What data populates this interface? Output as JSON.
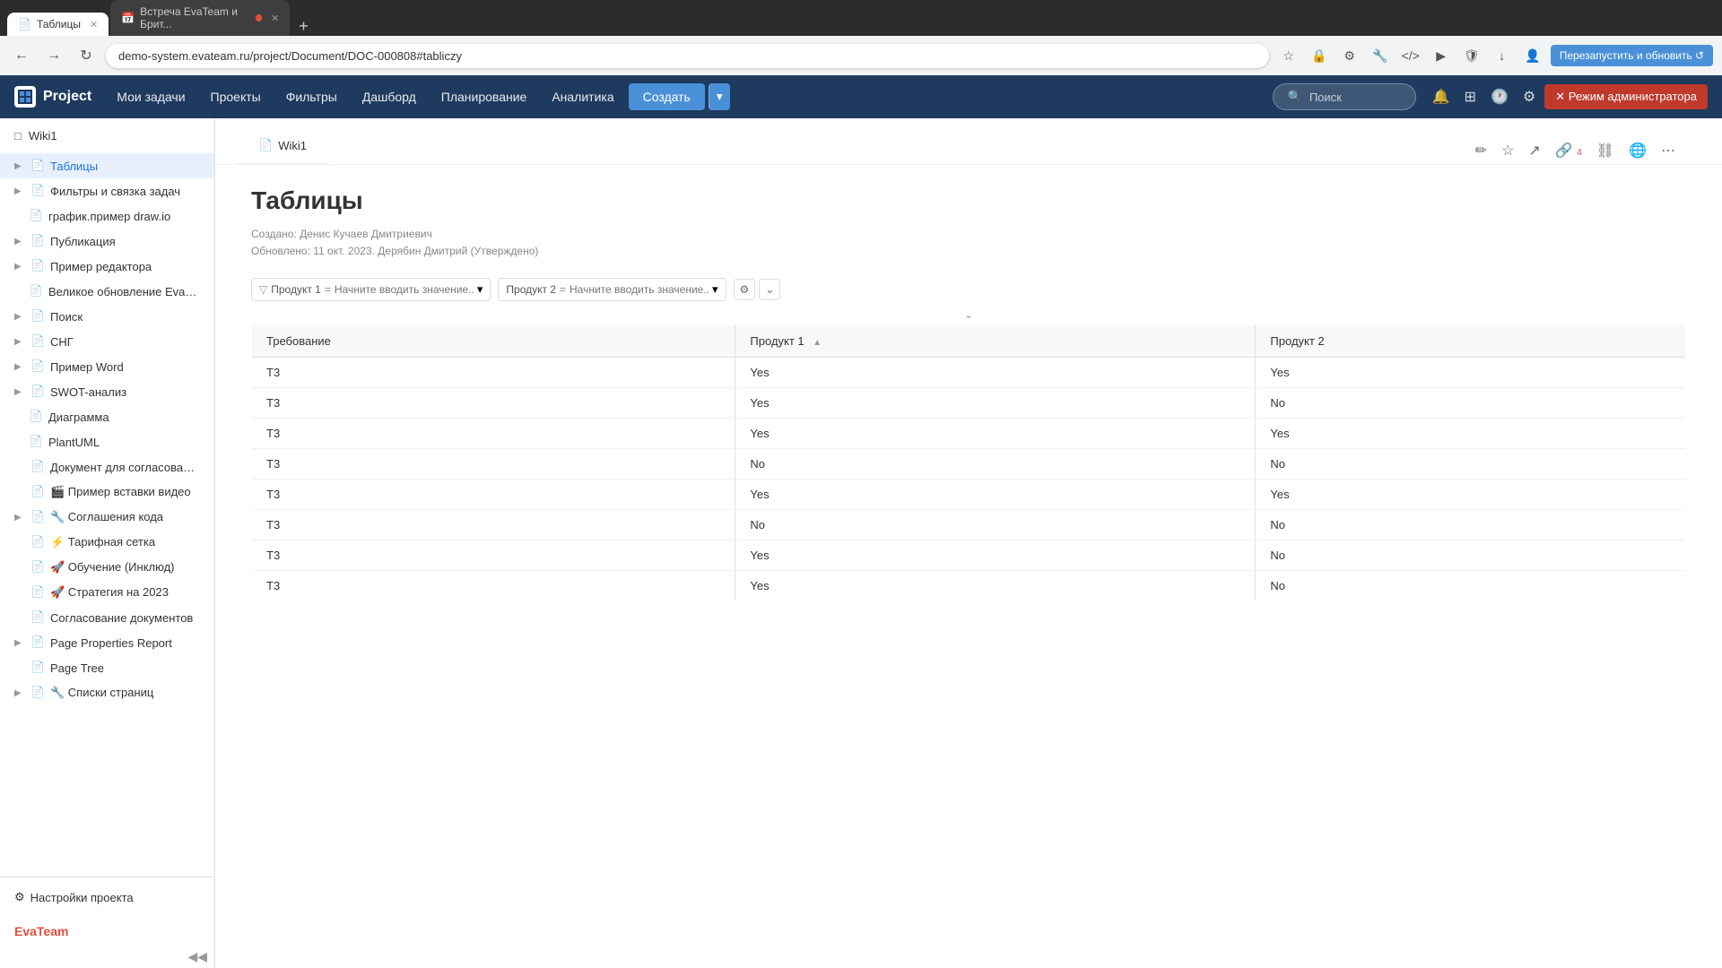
{
  "browser": {
    "tabs": [
      {
        "id": "tab1",
        "label": "Таблицы",
        "active": true,
        "icon": "📄"
      },
      {
        "id": "tab2",
        "label": "Встреча EvaTeam и Брит...",
        "active": false,
        "icon": "📅"
      }
    ],
    "address": "demo-system.evateam.ru/project/Document/DOC-000808#tabliczy",
    "restart_label": "Перезапустить и обновить ↺"
  },
  "nav": {
    "logo": "Project",
    "items": [
      "Мои задачи",
      "Проекты",
      "Фильтры",
      "Дашборд",
      "Планирование",
      "Аналитика"
    ],
    "create_label": "Создать",
    "search_placeholder": "Поиск",
    "admin_label": "✕ Режим администратора"
  },
  "sidebar": {
    "wiki_title": "Wiki1",
    "items": [
      {
        "id": "tablicy",
        "label": "Таблицы",
        "active": true,
        "expandable": true,
        "icon": "📄",
        "indent": 0
      },
      {
        "id": "filtry",
        "label": "Фильтры и связка задач",
        "active": false,
        "expandable": true,
        "icon": "📄",
        "indent": 0
      },
      {
        "id": "grafik",
        "label": "график.пример draw.io",
        "active": false,
        "expandable": false,
        "icon": "📄",
        "indent": 1
      },
      {
        "id": "publikaciya",
        "label": "Публикация",
        "active": false,
        "expandable": true,
        "icon": "📄",
        "indent": 0
      },
      {
        "id": "primer-red",
        "label": "Пример редактора",
        "active": false,
        "expandable": true,
        "icon": "📄",
        "indent": 0
      },
      {
        "id": "velikoe",
        "label": "Великое обновление EvaP...",
        "active": false,
        "expandable": false,
        "icon": "📄",
        "indent": 1
      },
      {
        "id": "poisk",
        "label": "Поиск",
        "active": false,
        "expandable": true,
        "icon": "📄",
        "indent": 0
      },
      {
        "id": "sng",
        "label": "СНГ",
        "active": false,
        "expandable": true,
        "icon": "📄",
        "indent": 0
      },
      {
        "id": "primer-word",
        "label": "Пример Word",
        "active": false,
        "expandable": true,
        "icon": "📄",
        "indent": 0
      },
      {
        "id": "swot",
        "label": "SWOT-анализ",
        "active": false,
        "expandable": true,
        "icon": "📄",
        "indent": 0
      },
      {
        "id": "diagramma",
        "label": "Диаграмма",
        "active": false,
        "expandable": false,
        "icon": "📄",
        "indent": 1
      },
      {
        "id": "plantuml",
        "label": "PlantUML",
        "active": false,
        "expandable": false,
        "icon": "📄",
        "indent": 1
      },
      {
        "id": "soglasovanie",
        "label": "Документ для согласования",
        "active": false,
        "expandable": false,
        "icon": "📄",
        "indent": 0
      },
      {
        "id": "video",
        "label": "🎬 Пример вставки видео",
        "active": false,
        "expandable": false,
        "icon": "📄",
        "indent": 0
      },
      {
        "id": "soglasheniya",
        "label": "🔧 Соглашения кода",
        "active": false,
        "expandable": true,
        "icon": "📄",
        "indent": 0
      },
      {
        "id": "tarifnaya",
        "label": "⚡ Тарифная сетка",
        "active": false,
        "expandable": false,
        "icon": "📄",
        "indent": 0
      },
      {
        "id": "obuchenie",
        "label": "🚀 Обучение (Инклюд)",
        "active": false,
        "expandable": false,
        "icon": "📄",
        "indent": 0
      },
      {
        "id": "strategiya",
        "label": "🚀 Стратегия на 2023",
        "active": false,
        "expandable": false,
        "icon": "📄",
        "indent": 0
      },
      {
        "id": "soglasovanie-doc",
        "label": "Согласование документов",
        "active": false,
        "expandable": false,
        "icon": "📄",
        "indent": 0
      },
      {
        "id": "page-properties-report",
        "label": "Page Properties Report",
        "active": false,
        "expandable": true,
        "icon": "📄",
        "indent": 0
      },
      {
        "id": "page-tree",
        "label": "Page Tree",
        "active": false,
        "expandable": false,
        "icon": "📄",
        "indent": 0
      },
      {
        "id": "spiski",
        "label": "🔧 Списки страниц",
        "active": false,
        "expandable": true,
        "icon": "📄",
        "indent": 0
      }
    ],
    "settings_label": "Настройки проекта",
    "collapse_icon": "◀◀"
  },
  "page": {
    "breadcrumb": "Wiki1",
    "breadcrumb_icon": "📄",
    "title": "Таблицы",
    "created_by": "Создано: Денис Кучаев Дмитриевич",
    "updated": "Обновлено: 11 окт. 2023. Дерябин Дмитрий  (Утверждено)"
  },
  "filter_bar": {
    "product1_label": "Продукт 1",
    "product1_eq": "=",
    "product1_placeholder": "Начните вводить значение...",
    "product2_label": "Продукт 2",
    "product2_eq": "=",
    "product2_placeholder": "Начните вводить значение..."
  },
  "table": {
    "columns": [
      "Требование",
      "Продукт 1",
      "Продукт 2"
    ],
    "rows": [
      {
        "req": "Т3",
        "prod1": "Yes",
        "prod2": "Yes"
      },
      {
        "req": "Т3",
        "prod1": "Yes",
        "prod2": "No"
      },
      {
        "req": "Т3",
        "prod1": "Yes",
        "prod2": "Yes"
      },
      {
        "req": "Т3",
        "prod1": "No",
        "prod2": "No"
      },
      {
        "req": "Т3",
        "prod1": "Yes",
        "prod2": "Yes"
      },
      {
        "req": "Т3",
        "prod1": "No",
        "prod2": "No"
      },
      {
        "req": "Т3",
        "prod1": "Yes",
        "prod2": "No"
      },
      {
        "req": "Т3",
        "prod1": "Yes",
        "prod2": "No"
      }
    ]
  },
  "header_icons": {
    "edit": "✏️",
    "star": "☆",
    "share": "↗",
    "attach_count": "4",
    "link": "🔗",
    "globe": "🌐",
    "more": "⋯"
  }
}
